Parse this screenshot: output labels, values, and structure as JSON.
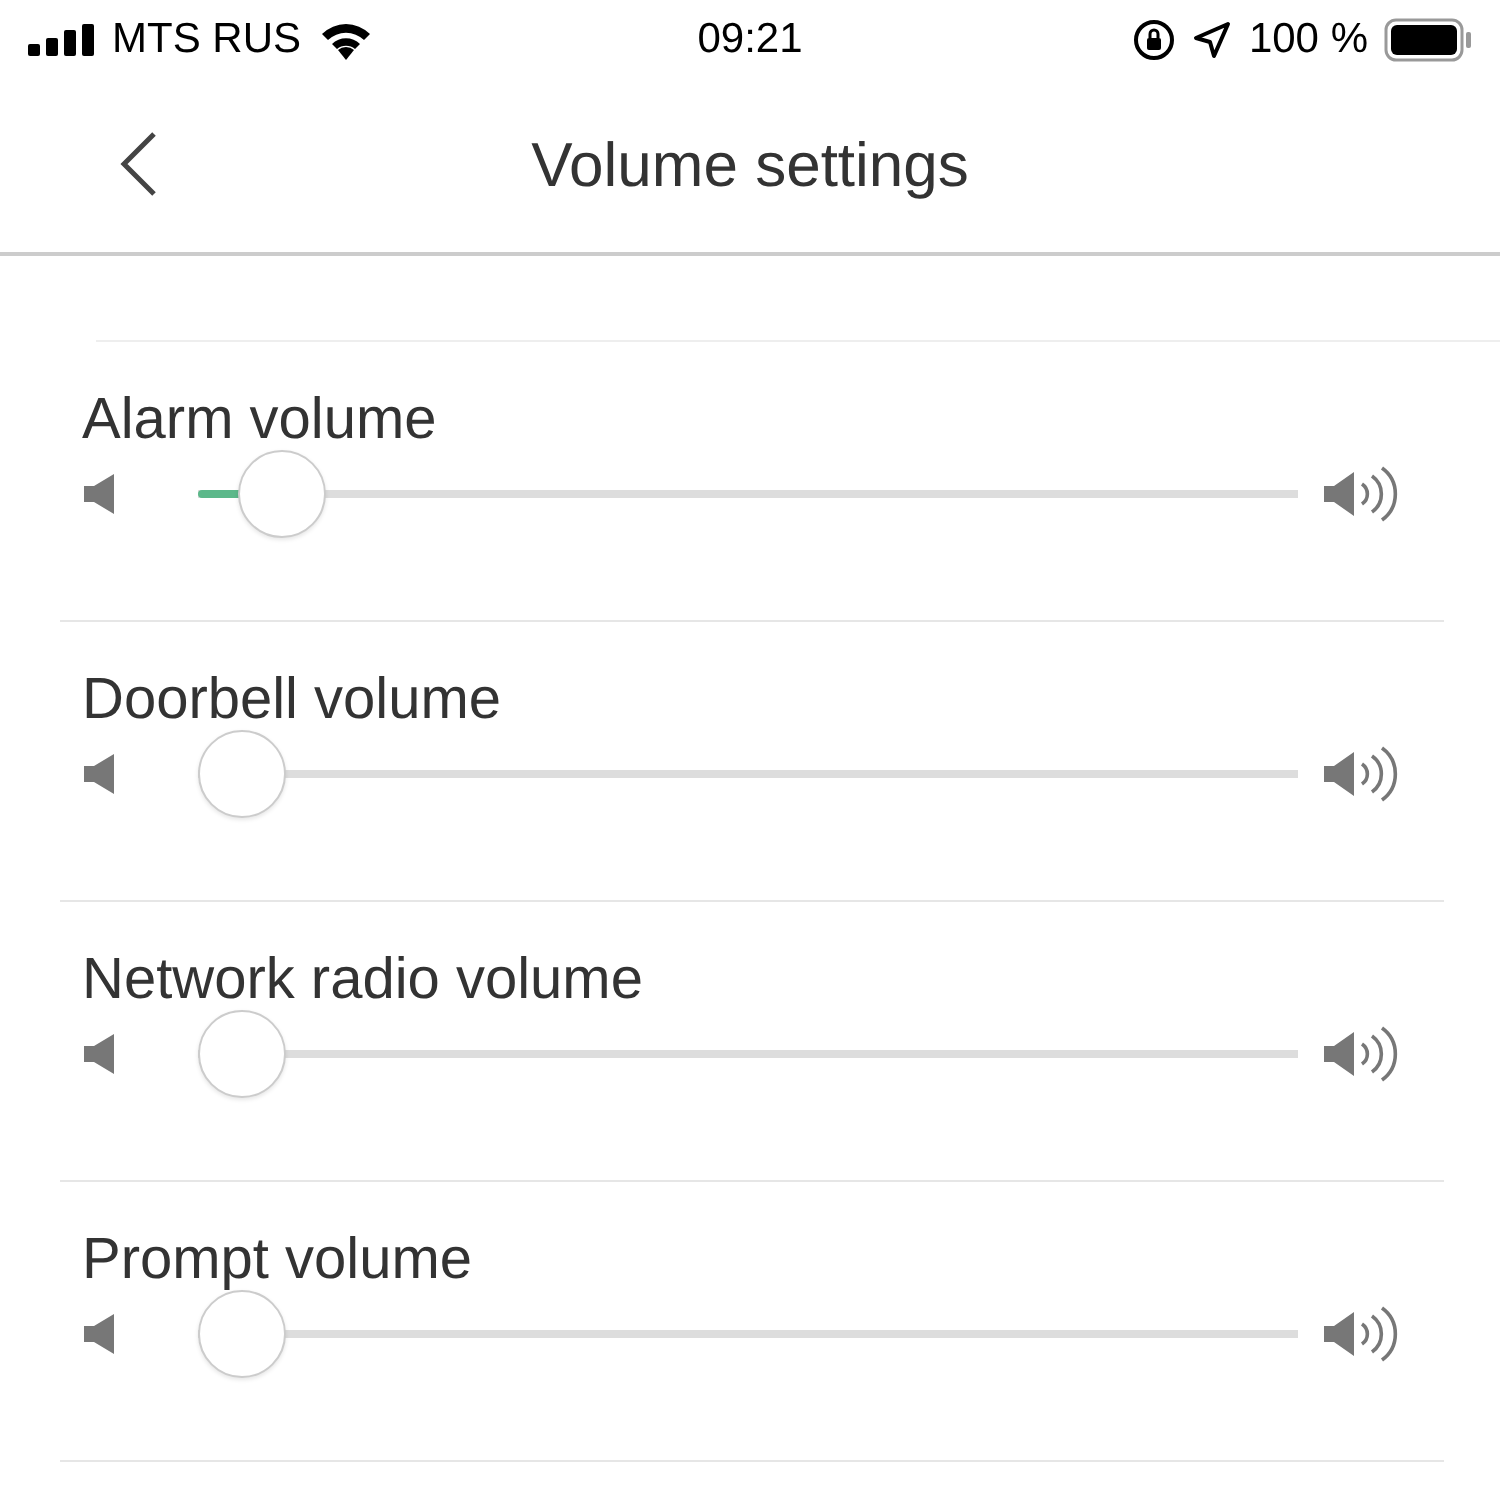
{
  "status_bar": {
    "carrier": "MTS RUS",
    "time": "09:21",
    "battery": "100 %"
  },
  "nav": {
    "title": "Volume settings"
  },
  "sliders": [
    {
      "label": "Alarm volume",
      "level": 0.04
    },
    {
      "label": "Doorbell volume",
      "level": 0
    },
    {
      "label": "Network radio volume",
      "level": 0
    },
    {
      "label": "Prompt volume",
      "level": 0
    }
  ]
}
